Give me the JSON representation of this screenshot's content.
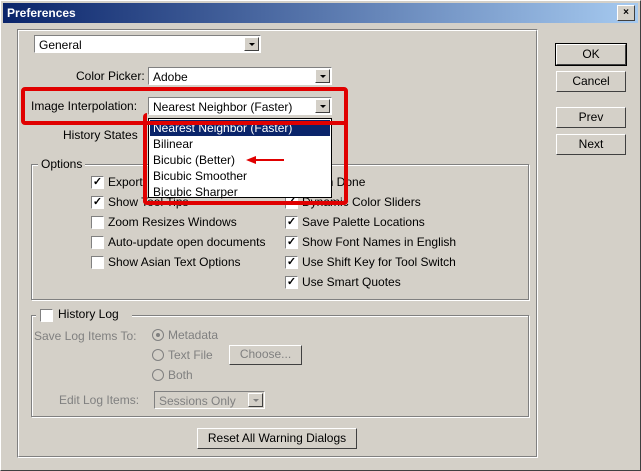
{
  "window": {
    "title": "Preferences",
    "close_label": "×"
  },
  "section_select": {
    "value": "General"
  },
  "color_picker": {
    "label": "Color Picker:",
    "value": "Adobe"
  },
  "image_interpolation": {
    "label": "Image Interpolation:",
    "value": "Nearest Neighbor (Faster)",
    "options": [
      "Nearest Neighbor (Faster)",
      "Bilinear",
      "Bicubic (Better)",
      "Bicubic Smoother",
      "Bicubic Sharper"
    ],
    "selected_index": 0
  },
  "history_states": {
    "label": "History States"
  },
  "options_group": {
    "title": "Options",
    "left": [
      {
        "label": "Export",
        "checked": true
      },
      {
        "label": "Show Tool Tips",
        "checked": true
      },
      {
        "label": "Zoom Resizes Windows",
        "checked": false
      },
      {
        "label": "Auto-update open documents",
        "checked": false
      },
      {
        "label": "Show Asian Text Options",
        "checked": false
      }
    ],
    "right": [
      {
        "label": "When Done",
        "checked": true
      },
      {
        "label": "Dynamic Color Sliders",
        "checked": true
      },
      {
        "label": "Save Palette Locations",
        "checked": true
      },
      {
        "label": "Show Font Names in English",
        "checked": true
      },
      {
        "label": "Use Shift Key for Tool Switch",
        "checked": true
      },
      {
        "label": "Use Smart Quotes",
        "checked": true
      }
    ]
  },
  "history_log": {
    "title": "History Log",
    "checked": false,
    "save_log_label": "Save Log Items To:",
    "radio_metadata": "Metadata",
    "radio_text_file": "Text File",
    "radio_both": "Both",
    "choose_button": "Choose...",
    "edit_log_label": "Edit Log Items:",
    "edit_log_value": "Sessions Only"
  },
  "reset_button": "Reset All Warning Dialogs",
  "buttons": {
    "ok": "OK",
    "cancel": "Cancel",
    "prev": "Prev",
    "next": "Next"
  },
  "colors": {
    "highlight": "#e00000",
    "titlebar": "#0a246a",
    "face": "#d4d0c8"
  }
}
